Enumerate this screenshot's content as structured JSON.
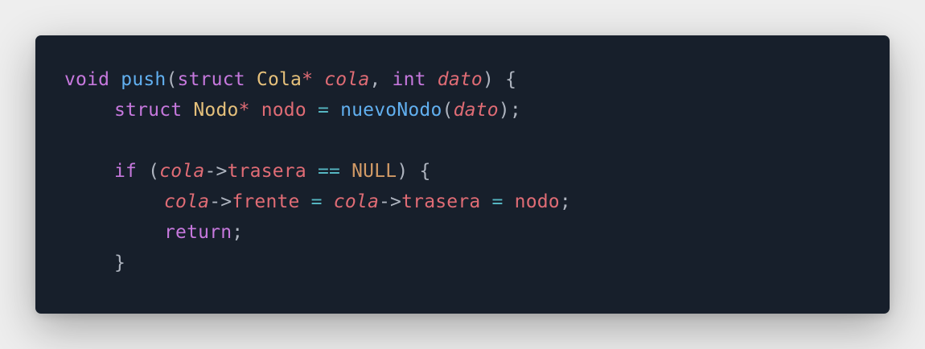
{
  "code_block": {
    "language": "c",
    "lines": [
      {
        "tokens": [
          {
            "text": "void",
            "kind": "kw"
          },
          {
            "text": " ",
            "kind": "sp"
          },
          {
            "text": "push",
            "kind": "fn"
          },
          {
            "text": "(",
            "kind": "punc"
          },
          {
            "text": "struct",
            "kind": "kw"
          },
          {
            "text": " ",
            "kind": "sp"
          },
          {
            "text": "Cola",
            "kind": "type"
          },
          {
            "text": "*",
            "kind": "var"
          },
          {
            "text": " ",
            "kind": "sp"
          },
          {
            "text": "cola",
            "kind": "param"
          },
          {
            "text": ",",
            "kind": "punc"
          },
          {
            "text": " ",
            "kind": "sp"
          },
          {
            "text": "int",
            "kind": "kw"
          },
          {
            "text": " ",
            "kind": "sp"
          },
          {
            "text": "dato",
            "kind": "param"
          },
          {
            "text": ")",
            "kind": "punc"
          },
          {
            "text": " ",
            "kind": "sp"
          },
          {
            "text": "{",
            "kind": "brace"
          }
        ]
      },
      {
        "indent": 1,
        "tokens": [
          {
            "text": "struct",
            "kind": "kw"
          },
          {
            "text": " ",
            "kind": "sp"
          },
          {
            "text": "Nodo",
            "kind": "type"
          },
          {
            "text": "*",
            "kind": "var"
          },
          {
            "text": " ",
            "kind": "sp"
          },
          {
            "text": "nodo",
            "kind": "var"
          },
          {
            "text": " ",
            "kind": "sp"
          },
          {
            "text": "=",
            "kind": "op"
          },
          {
            "text": " ",
            "kind": "sp"
          },
          {
            "text": "nuevoNodo",
            "kind": "fn"
          },
          {
            "text": "(",
            "kind": "punc"
          },
          {
            "text": "dato",
            "kind": "param"
          },
          {
            "text": ")",
            "kind": "punc"
          },
          {
            "text": ";",
            "kind": "punc"
          }
        ]
      },
      {
        "tokens": []
      },
      {
        "indent": 1,
        "tokens": [
          {
            "text": "if",
            "kind": "kw"
          },
          {
            "text": " ",
            "kind": "sp"
          },
          {
            "text": "(",
            "kind": "punc"
          },
          {
            "text": "cola",
            "kind": "param"
          },
          {
            "text": "->",
            "kind": "punc"
          },
          {
            "text": "trasera",
            "kind": "var"
          },
          {
            "text": " ",
            "kind": "sp"
          },
          {
            "text": "==",
            "kind": "op"
          },
          {
            "text": " ",
            "kind": "sp"
          },
          {
            "text": "NULL",
            "kind": "const"
          },
          {
            "text": ")",
            "kind": "punc"
          },
          {
            "text": " ",
            "kind": "sp"
          },
          {
            "text": "{",
            "kind": "brace"
          }
        ]
      },
      {
        "indent": 2,
        "tokens": [
          {
            "text": "cola",
            "kind": "param"
          },
          {
            "text": "->",
            "kind": "punc"
          },
          {
            "text": "frente",
            "kind": "var"
          },
          {
            "text": " ",
            "kind": "sp"
          },
          {
            "text": "=",
            "kind": "op"
          },
          {
            "text": " ",
            "kind": "sp"
          },
          {
            "text": "cola",
            "kind": "param"
          },
          {
            "text": "->",
            "kind": "punc"
          },
          {
            "text": "trasera",
            "kind": "var"
          },
          {
            "text": " ",
            "kind": "sp"
          },
          {
            "text": "=",
            "kind": "op"
          },
          {
            "text": " ",
            "kind": "sp"
          },
          {
            "text": "nodo",
            "kind": "var"
          },
          {
            "text": ";",
            "kind": "punc"
          }
        ]
      },
      {
        "indent": 2,
        "tokens": [
          {
            "text": "return",
            "kind": "kw"
          },
          {
            "text": ";",
            "kind": "punc"
          }
        ]
      },
      {
        "indent": 1,
        "tokens": [
          {
            "text": "}",
            "kind": "brace"
          }
        ]
      }
    ]
  },
  "theme": {
    "background": "#171f2b",
    "page_background": "#eeeeee",
    "keyword": "#c678dd",
    "function": "#61afef",
    "type": "#e5c07b",
    "variable": "#e06c75",
    "constant": "#d19a66",
    "operator": "#56b6c2",
    "punctuation": "#aeb4bf"
  }
}
